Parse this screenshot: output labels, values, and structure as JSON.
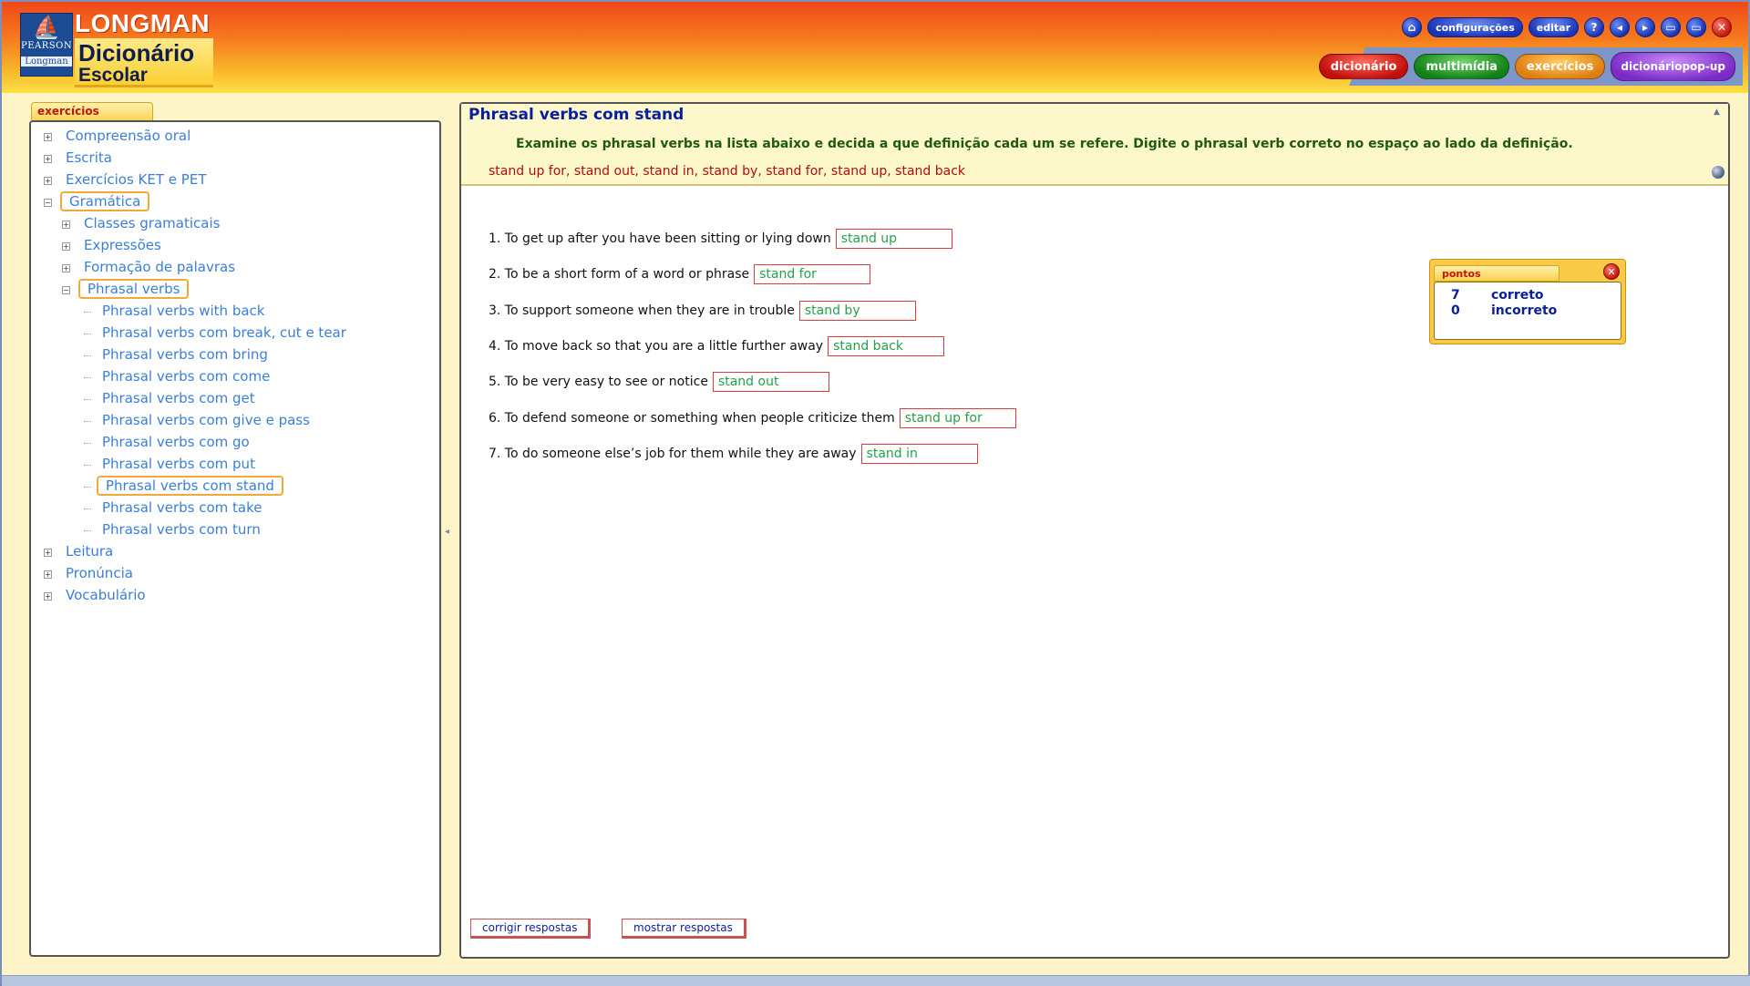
{
  "brand": {
    "top": "LONGMAN",
    "title": "Dicionário",
    "subtitle": "Escolar",
    "publisher": "PEARSON",
    "publisher_sub": "Longman"
  },
  "toolbar": {
    "home_icon": "⌂",
    "settings_label": "configurações",
    "edit_label": "editar",
    "help_icon": "?",
    "back_icon": "◂",
    "forward_icon": "▸",
    "minimize_icon": "▭",
    "maximize_icon": "▭",
    "close_icon": "✕"
  },
  "nav": {
    "dictionary": "dicionário",
    "multimedia": "multimídia",
    "exercises": "exercícios",
    "popup_line1": "dicionário",
    "popup_line2": "pop-up"
  },
  "sidebar": {
    "tab_label": "exercícios",
    "tree": [
      {
        "label": "Compreensão oral",
        "level": 0,
        "toggle": "+",
        "selected": false
      },
      {
        "label": "Escrita",
        "level": 0,
        "toggle": "+",
        "selected": false
      },
      {
        "label": "Exercícios KET e PET",
        "level": 0,
        "toggle": "+",
        "selected": false
      },
      {
        "label": "Gramática",
        "level": 0,
        "toggle": "−",
        "selected": true
      },
      {
        "label": "Classes gramaticais",
        "level": 1,
        "toggle": "+",
        "selected": false
      },
      {
        "label": "Expressões",
        "level": 1,
        "toggle": "+",
        "selected": false
      },
      {
        "label": "Formação de palavras",
        "level": 1,
        "toggle": "+",
        "selected": false
      },
      {
        "label": "Phrasal verbs",
        "level": 1,
        "toggle": "−",
        "selected": true
      },
      {
        "label": "Phrasal verbs with back",
        "level": 2,
        "toggle": "",
        "selected": false
      },
      {
        "label": "Phrasal verbs com break, cut e tear",
        "level": 2,
        "toggle": "",
        "selected": false
      },
      {
        "label": "Phrasal verbs com bring",
        "level": 2,
        "toggle": "",
        "selected": false
      },
      {
        "label": "Phrasal verbs com come",
        "level": 2,
        "toggle": "",
        "selected": false
      },
      {
        "label": "Phrasal verbs com get",
        "level": 2,
        "toggle": "",
        "selected": false
      },
      {
        "label": "Phrasal verbs com give e pass",
        "level": 2,
        "toggle": "",
        "selected": false
      },
      {
        "label": "Phrasal verbs com go",
        "level": 2,
        "toggle": "",
        "selected": false
      },
      {
        "label": "Phrasal verbs com put",
        "level": 2,
        "toggle": "",
        "selected": false
      },
      {
        "label": "Phrasal verbs com stand",
        "level": 2,
        "toggle": "",
        "selected": true
      },
      {
        "label": "Phrasal verbs com take",
        "level": 2,
        "toggle": "",
        "selected": false
      },
      {
        "label": "Phrasal verbs com turn",
        "level": 2,
        "toggle": "",
        "selected": false
      },
      {
        "label": "Leitura",
        "level": 0,
        "toggle": "+",
        "selected": false
      },
      {
        "label": "Pronúncia",
        "level": 0,
        "toggle": "+",
        "selected": false
      },
      {
        "label": "Vocabulário",
        "level": 0,
        "toggle": "+",
        "selected": false
      }
    ]
  },
  "main": {
    "title": "Phrasal verbs com stand",
    "instructions": "Examine os phrasal verbs na lista abaixo e decida a que definição cada um se refere. Digite o phrasal verb correto no espaço ao lado da definição.",
    "wordlist": "stand up for, stand out, stand in, stand by, stand for, stand up, stand back",
    "questions": [
      {
        "text": "1. To get up after you have been sitting or lying down",
        "answer": "stand up"
      },
      {
        "text": "2. To be a short form of a word or phrase",
        "answer": "stand for"
      },
      {
        "text": "3. To support someone when they are in trouble",
        "answer": "stand by"
      },
      {
        "text": "4. To move back so that you are a little further away",
        "answer": "stand back"
      },
      {
        "text": "5. To be very easy to see or notice",
        "answer": "stand out"
      },
      {
        "text": "6. To defend someone or something when people criticize them",
        "answer": "stand up for"
      },
      {
        "text": "7. To do someone else’s job for them while they are away",
        "answer": "stand in"
      }
    ],
    "check_button": "corrigir respostas",
    "show_button": "mostrar respostas"
  },
  "score": {
    "tab_label": "pontos",
    "correct_count": "7",
    "correct_label": "correto",
    "incorrect_count": "0",
    "incorrect_label": "incorreto"
  },
  "colors": {
    "link_blue": "#3a7fd6",
    "title_blue": "#0a1f9e",
    "answer_green": "#25a14b",
    "input_border_red": "#e03a3a",
    "instruction_green": "#1f5a0d",
    "wordlist_red": "#b00d0d",
    "selection_orange": "#f3a93a"
  }
}
